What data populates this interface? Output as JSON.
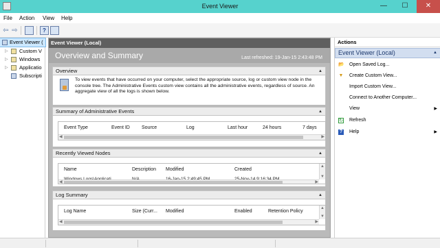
{
  "window": {
    "title": "Event Viewer",
    "minimize": "—",
    "maximize": "☐",
    "close": "✕"
  },
  "menu": [
    "File",
    "Action",
    "View",
    "Help"
  ],
  "toolbar": {
    "back": "⇦",
    "forward": "⇨",
    "help": "?"
  },
  "tree": {
    "items": [
      {
        "label": "Event Viewer (",
        "arrow": "",
        "selected": true
      },
      {
        "label": "Custom V",
        "arrow": "▷"
      },
      {
        "label": "Windows",
        "arrow": "▷"
      },
      {
        "label": "Applicatio",
        "arrow": "▷"
      },
      {
        "label": "Subscripti",
        "arrow": ""
      }
    ]
  },
  "center": {
    "header": "Event Viewer (Local)",
    "title": "Overview and Summary",
    "last_refreshed": "Last refreshed: 19-Jan-15 2:43:48 PM",
    "collapse_glyph": "▲",
    "overview": {
      "label": "Overview",
      "text": "To view events that have occurred on your computer, select the appropriate source, log or custom view node in the console tree. The Administrative Events custom view contains all the administrative events, regardless of source. An aggregate view of all the logs is shown below."
    },
    "admin_events": {
      "label": "Summary of Administrative Events",
      "columns": [
        "Event Type",
        "Event ID",
        "Source",
        "Log",
        "Last hour",
        "24 hours",
        "7 days"
      ]
    },
    "recent_nodes": {
      "label": "Recently Viewed Nodes",
      "columns": [
        "Name",
        "Description",
        "Modified",
        "Created"
      ],
      "rows": [
        [
          "Windows Logs\\Applicati",
          "N/A",
          "16-Jan-15 2:49:45 PM",
          "25-Nov-14 9:16:34 PM"
        ]
      ]
    },
    "log_summary": {
      "label": "Log Summary",
      "columns": [
        "Log Name",
        "Size (Curr...",
        "Modified",
        "Enabled",
        "Retention Policy"
      ]
    }
  },
  "actions": {
    "title": "Actions",
    "group": "Event Viewer (Local)",
    "items": [
      {
        "label": "Open Saved Log...",
        "icon": "folder-icon",
        "glyph": "📂"
      },
      {
        "label": "Create Custom View...",
        "icon": "filter-icon",
        "glyph": "▼"
      },
      {
        "label": "Import Custom View...",
        "icon": "",
        "glyph": ""
      },
      {
        "label": "Connect to Another Computer...",
        "icon": "",
        "glyph": ""
      },
      {
        "label": "View",
        "icon": "",
        "glyph": "",
        "submenu": "▶"
      },
      {
        "label": "Refresh",
        "icon": "refresh-icon",
        "glyph": "↻"
      },
      {
        "label": "Help",
        "icon": "help-icon",
        "glyph": "?",
        "submenu": "▶"
      }
    ]
  },
  "colors": {
    "titlebar": "#56d2cd",
    "close": "#c7504b",
    "actions_group": "#d2def0",
    "center_head": "#5f5f5f",
    "center_band": "#a9a9a9"
  }
}
